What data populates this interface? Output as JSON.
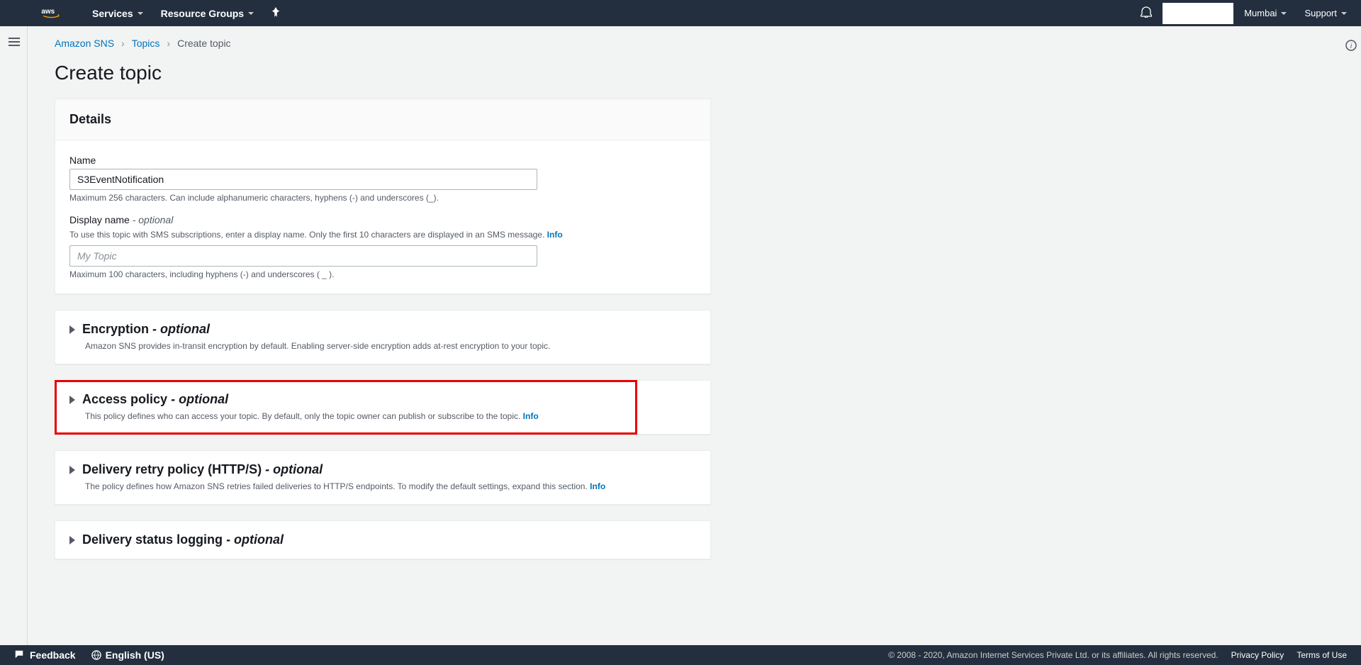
{
  "nav": {
    "services": "Services",
    "resource_groups": "Resource Groups",
    "region": "Mumbai",
    "support": "Support"
  },
  "breadcrumb": {
    "a": "Amazon SNS",
    "b": "Topics",
    "c": "Create topic"
  },
  "page_title": "Create topic",
  "details": {
    "header": "Details",
    "name_label": "Name",
    "name_value": "S3EventNotification",
    "name_hint": "Maximum 256 characters. Can include alphanumeric characters, hyphens (-) and underscores (_).",
    "display_label": "Display name",
    "display_opt": "- optional",
    "display_desc": "To use this topic with SMS subscriptions, enter a display name. Only the first 10 characters are displayed in an SMS message.",
    "display_placeholder": "My Topic",
    "display_hint": "Maximum 100 characters, including hyphens (-) and underscores ( _ ).",
    "info": "Info"
  },
  "encryption": {
    "title": "Encryption",
    "opt": "- optional",
    "desc": "Amazon SNS provides in-transit encryption by default. Enabling server-side encryption adds at-rest encryption to your topic."
  },
  "access": {
    "title": "Access policy",
    "opt": "- optional",
    "desc": "This policy defines who can access your topic. By default, only the topic owner can publish or subscribe to the topic.",
    "info": "Info"
  },
  "retry": {
    "title": "Delivery retry policy (HTTP/S)",
    "opt": "- optional",
    "desc": "The policy defines how Amazon SNS retries failed deliveries to HTTP/S endpoints. To modify the default settings, expand this section.",
    "info": "Info"
  },
  "logging": {
    "title": "Delivery status logging",
    "opt": "- optional"
  },
  "footer": {
    "feedback": "Feedback",
    "lang": "English (US)",
    "copyright": "© 2008 - 2020, Amazon Internet Services Private Ltd. or its affiliates. All rights reserved.",
    "privacy": "Privacy Policy",
    "terms": "Terms of Use"
  }
}
